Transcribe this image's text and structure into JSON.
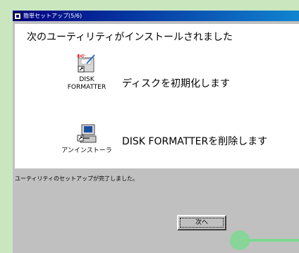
{
  "window": {
    "title": "簡単セットアップ(5/6)"
  },
  "main": {
    "heading": "次のユーティリティがインストールされました",
    "items": [
      {
        "icon_label": "DISK\nFORMATTER",
        "description": "ディスクを初期化します",
        "icon": "disk-formatter-icon"
      },
      {
        "icon_label": "アンインストーラ",
        "description": "DISK FORMATTERを削除します",
        "icon": "uninstaller-icon"
      }
    ]
  },
  "status": {
    "text": "ユーティリティのセットアップが完了しました。"
  },
  "buttons": {
    "next_label": "次へ"
  },
  "colors": {
    "titlebar": "#000080",
    "window_face": "#c0c0c0",
    "background": "#c9e6bf",
    "cursor_highlight": "#7dd890"
  }
}
